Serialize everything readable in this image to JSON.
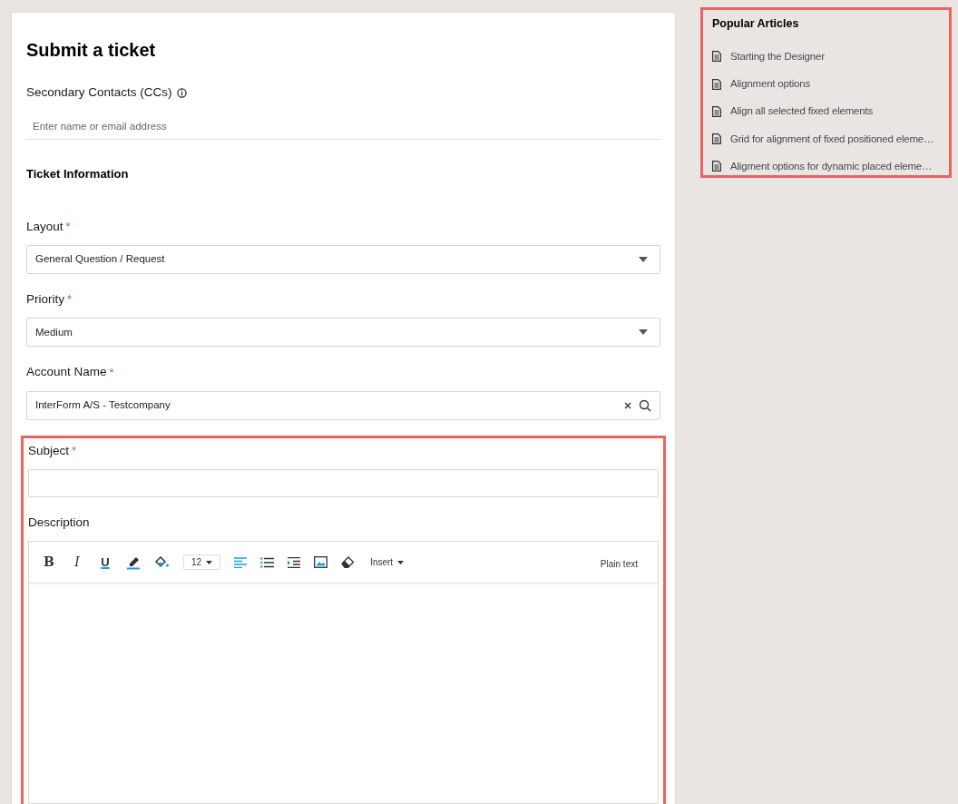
{
  "title": "Submit a ticket",
  "cc": {
    "label": "Secondary Contacts (CCs)",
    "placeholder": "Enter name or email address"
  },
  "section": "Ticket Information",
  "fields": [
    {
      "kind": "select",
      "label": "Layout",
      "required_mark": "*",
      "value": "General Question / Request"
    },
    {
      "kind": "select",
      "label": "Priority",
      "required_mark": "*",
      "value": "Medium"
    },
    {
      "kind": "lookup",
      "label": "Account Name",
      "required_mark": "*",
      "value": "InterForm A/S - Testcompany"
    }
  ],
  "highlight_group": {
    "highlighted": true,
    "subject": {
      "label": "Subject",
      "required_mark": "*"
    },
    "description": {
      "label": "Description",
      "toolbar": [
        {
          "kind": "bold",
          "text": "B"
        },
        {
          "kind": "italic",
          "text": "I"
        },
        {
          "kind": "underline",
          "text": "U"
        },
        {
          "kind": "pen"
        },
        {
          "kind": "fill"
        },
        {
          "kind": "size",
          "text": "12"
        },
        {
          "kind": "align"
        },
        {
          "kind": "list"
        },
        {
          "kind": "indent"
        },
        {
          "kind": "image"
        },
        {
          "kind": "eraser"
        },
        {
          "kind": "menu",
          "text": "Insert"
        }
      ],
      "mode": "Plain text"
    }
  },
  "popular_articles": {
    "highlighted": true,
    "title": "Popular Articles",
    "items": [
      "Starting the Designer",
      "Alignment options",
      "Align all selected fixed elements",
      "Grid for alignment of fixed positioned eleme…",
      "Aligment options for dynamic placed eleme…"
    ]
  }
}
